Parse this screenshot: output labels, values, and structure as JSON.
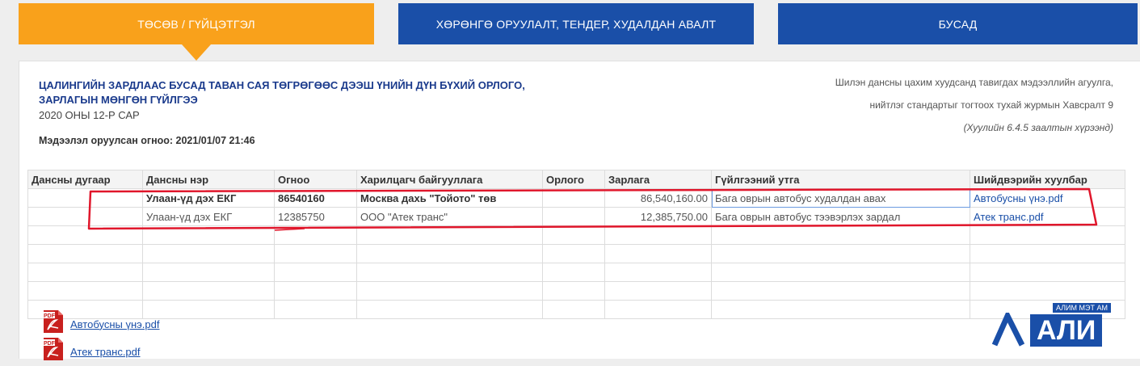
{
  "tabs": [
    {
      "label": "ТӨСӨВ / ГҮЙЦЭТГЭЛ"
    },
    {
      "label": "ХӨРӨНГӨ ОРУУЛАЛТ, ТЕНДЕР, ХУДАЛДАН АВАЛТ"
    },
    {
      "label": "БУСАД"
    }
  ],
  "doc": {
    "title": "ЦАЛИНГИЙН ЗАРДЛААС БУСАД ТАВАН САЯ ТӨГРӨГӨӨС ДЭЭШ ҮНИЙН ДҮН БҮХИЙ ОРЛОГО, ЗАРЛАГЫН МӨНГӨН ГҮЙЛГЭЭ",
    "subtitle": "2020 ОНЫ 12-Р САР",
    "date_label": "Мэдээлэл оруулсан огноо: 2021/01/07 21:46",
    "ref_line1": "Шилэн дансны цахим хуудсанд тавигдах мэдээллийн агуулга,",
    "ref_line2": "нийтлэг стандартыг тогтоох тухай журмын Хавсралт 9",
    "ref_line3": "(Хуулийн 6.4.5 заалтын хүрээнд)"
  },
  "table": {
    "headers": [
      "Дансны дугаар",
      "Дансны нэр",
      "Огноо",
      "Харилцагч байгууллага",
      "Орлого",
      "Зарлага",
      "Гүйлгээний утга",
      "Шийдвэрийн хуулбар"
    ],
    "rows": [
      [
        "",
        "Улаан-үд дэх ЕКГ",
        "86540160",
        "Москва дахь \"Тойото\" төв",
        "",
        "86,540,160.00",
        "Бага оврын автобус худалдан авах",
        "Автобусны үнэ.pdf"
      ],
      [
        "",
        "Улаан-үд дэх ЕКГ",
        "12385750",
        "ООО \"Атек транс\"",
        "",
        "12,385,750.00",
        "Бага оврын автобус тээвэрлэх зардал",
        "Атек транс.pdf"
      ]
    ]
  },
  "attachments": [
    {
      "label": "Автобусны үнэ.pdf",
      "icon": "pdf-icon"
    },
    {
      "label": "Атек транс.pdf",
      "icon": "pdf-icon"
    }
  ],
  "pdf_badge": "PDF",
  "watermark": {
    "small": "АЛИМ МЭТ АМ",
    "big": "АЛИ"
  },
  "colors": {
    "orange": "#f9a11b",
    "blue": "#1a4fa8",
    "highlight": "#e0162b"
  }
}
